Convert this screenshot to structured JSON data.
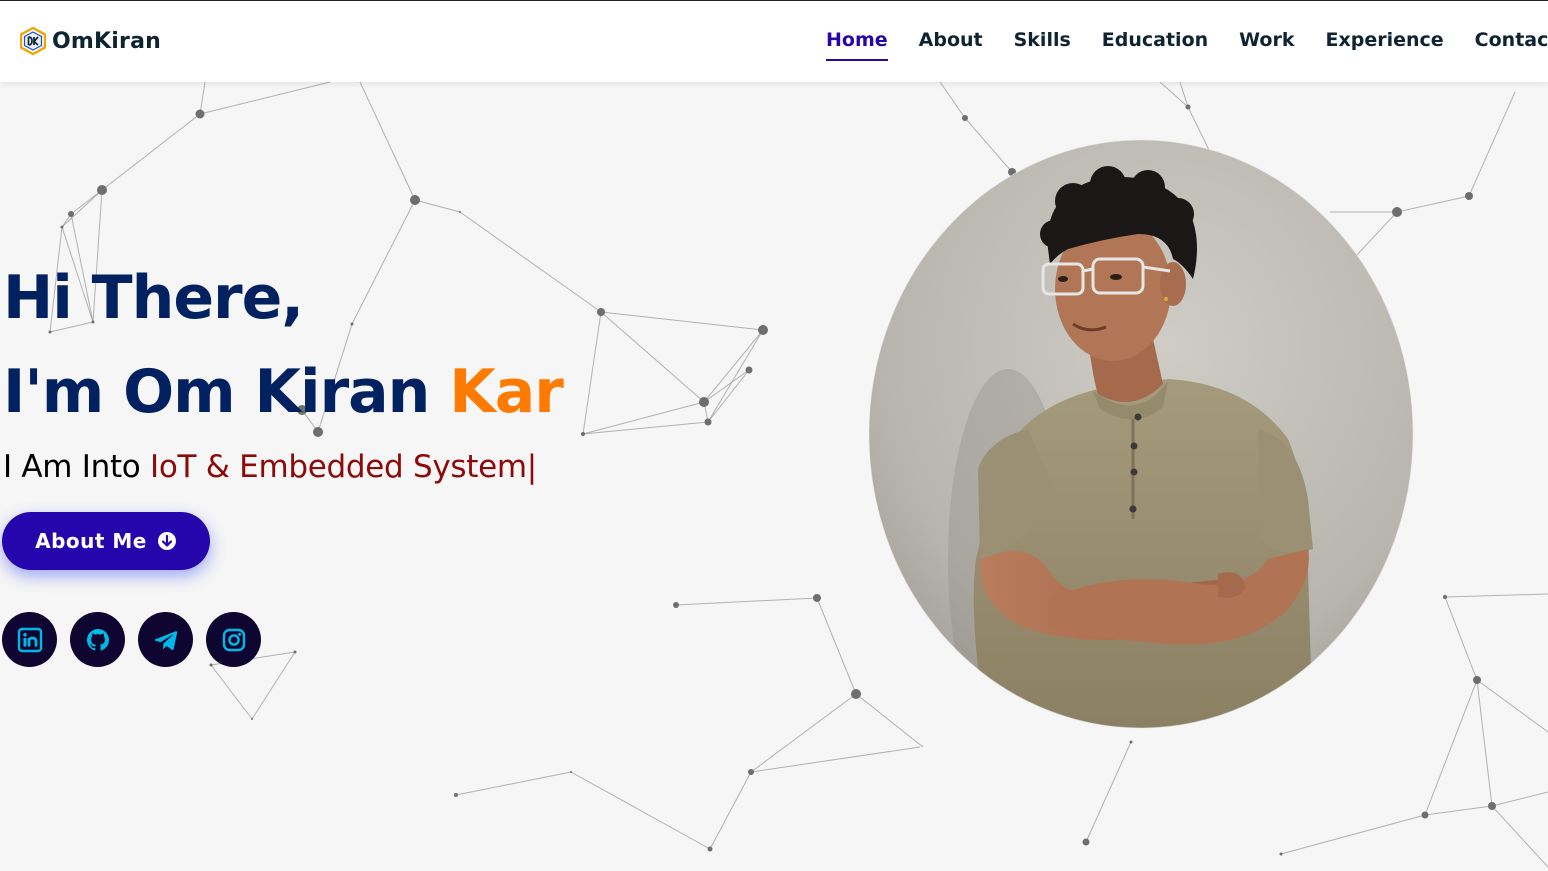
{
  "header": {
    "brand_name": "OmKiran",
    "nav": [
      {
        "label": "Home",
        "active": true
      },
      {
        "label": "About",
        "active": false
      },
      {
        "label": "Skills",
        "active": false
      },
      {
        "label": "Education",
        "active": false
      },
      {
        "label": "Work",
        "active": false
      },
      {
        "label": "Experience",
        "active": false
      },
      {
        "label": "Contact",
        "active": false
      }
    ]
  },
  "hero": {
    "greeting": "Hi There,",
    "name_prefix": "I'm Om Kiran",
    "name_highlight": "Kar",
    "typing_prefix": "I Am Into",
    "typing_value": "IoT & Embedded System",
    "typing_cursor": "|",
    "button_label": "About Me",
    "socials": [
      {
        "name": "linkedin",
        "icon": "linkedin-icon"
      },
      {
        "name": "github",
        "icon": "github-icon"
      },
      {
        "name": "telegram",
        "icon": "telegram-icon"
      },
      {
        "name": "instagram",
        "icon": "instagram-icon"
      }
    ]
  },
  "colors": {
    "nav_active": "#2506ad",
    "heading": "#012160",
    "name_highlight": "#ff7a00",
    "typed_text": "#8c0a0a",
    "button_bg": "#2506ad",
    "social_bg": "#0e0630",
    "social_icon": "#00b8e6",
    "background": "#f6f6f6"
  }
}
